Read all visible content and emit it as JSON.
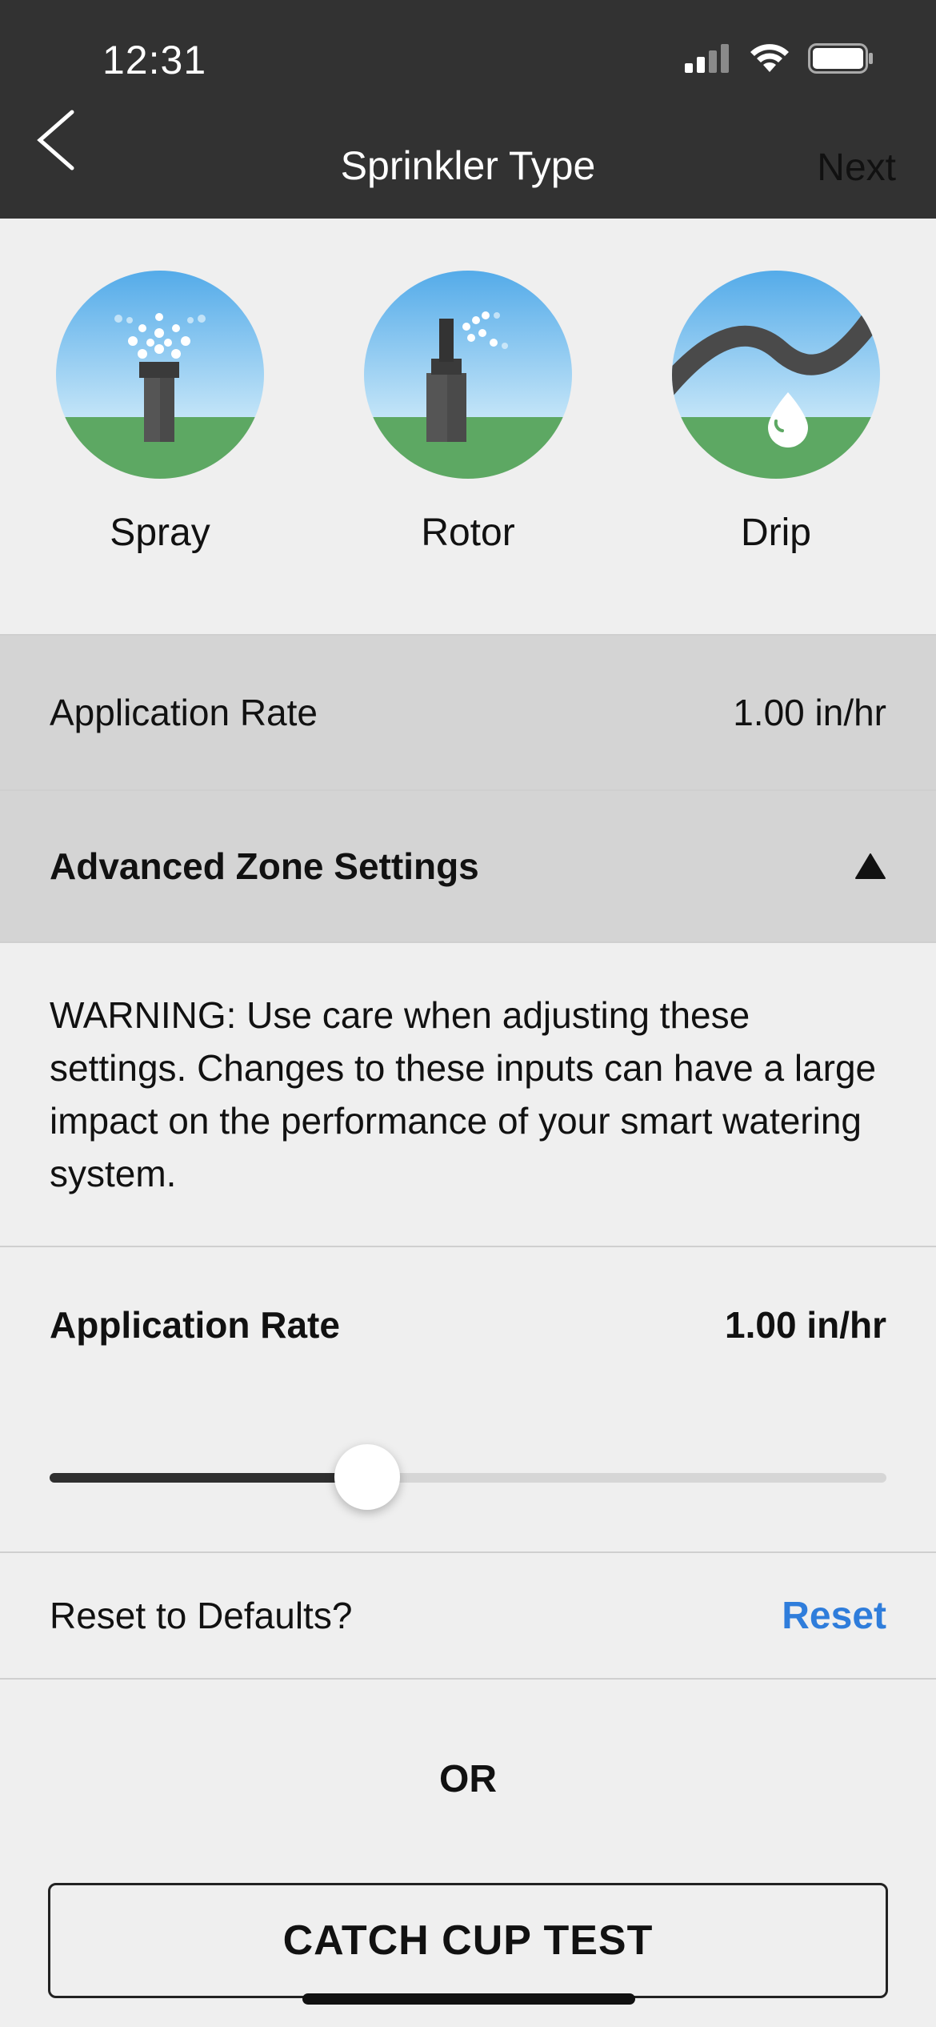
{
  "status_bar": {
    "time": "12:31"
  },
  "nav": {
    "title": "Sprinkler Type",
    "next_label": "Next"
  },
  "sprinkler_types": [
    {
      "label": "Spray",
      "icon": "spray-sprinkler-icon"
    },
    {
      "label": "Rotor",
      "icon": "rotor-sprinkler-icon"
    },
    {
      "label": "Drip",
      "icon": "drip-line-icon"
    }
  ],
  "application_rate_row": {
    "label": "Application Rate",
    "value": "1.00 in/hr"
  },
  "advanced": {
    "label": "Advanced Zone Settings",
    "expanded": true
  },
  "warning": {
    "text": "WARNING: Use care when adjusting these settings. Changes to these inputs can have a large impact on the performance of your smart watering system."
  },
  "advanced_rate": {
    "label": "Application Rate",
    "value": "1.00 in/hr",
    "slider_fraction": 0.38
  },
  "reset": {
    "question": "Reset to Defaults?",
    "link_label": "Reset"
  },
  "or_label": "OR",
  "catch_cup_button": "CATCH CUP TEST",
  "colors": {
    "header_bg": "#323232",
    "accent_blue": "#2f7ddb",
    "sky": "#5ab0ea",
    "grass": "#5da863"
  }
}
